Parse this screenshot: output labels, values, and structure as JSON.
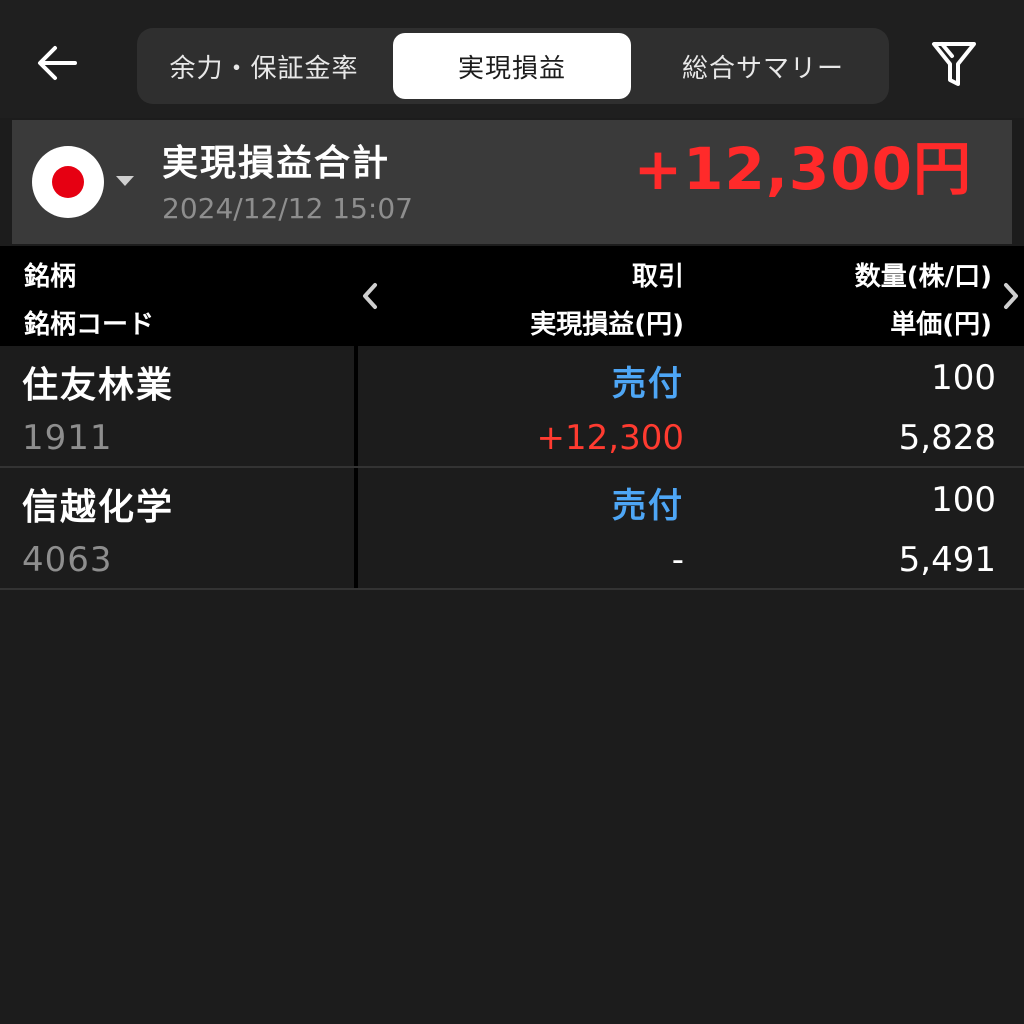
{
  "header": {
    "back_icon": "arrow-left-icon",
    "tabs": [
      {
        "label": "余力・保証金率",
        "selected": false
      },
      {
        "label": "実現損益",
        "selected": true
      },
      {
        "label": "総合サマリー",
        "selected": false
      }
    ],
    "filter_icon": "filter-icon"
  },
  "summary": {
    "flag_icon": "japan-flag-icon",
    "title": "実現損益合計",
    "date": "2024/12/12 15:07",
    "total": "+12,300円",
    "total_color": "#ff2a2a"
  },
  "columns": {
    "name": "銘柄",
    "code": "銘柄コード",
    "trade": "取引",
    "pl": "実現損益(円)",
    "qty": "数量(株/口)",
    "price": "単価(円)"
  },
  "rows": [
    {
      "name": "住友林業",
      "code": "1911",
      "trade": "売付",
      "pl": "+12,300",
      "qty": "100",
      "price": "5,828"
    },
    {
      "name": "信越化学",
      "code": "4063",
      "trade": "売付",
      "pl": "-",
      "qty": "100",
      "price": "5,491"
    }
  ],
  "colors": {
    "background": "#1c1c1c",
    "summary_bg": "#3a3a3a",
    "profit_red": "#ff3b30",
    "trade_blue": "#4ea6f5"
  }
}
